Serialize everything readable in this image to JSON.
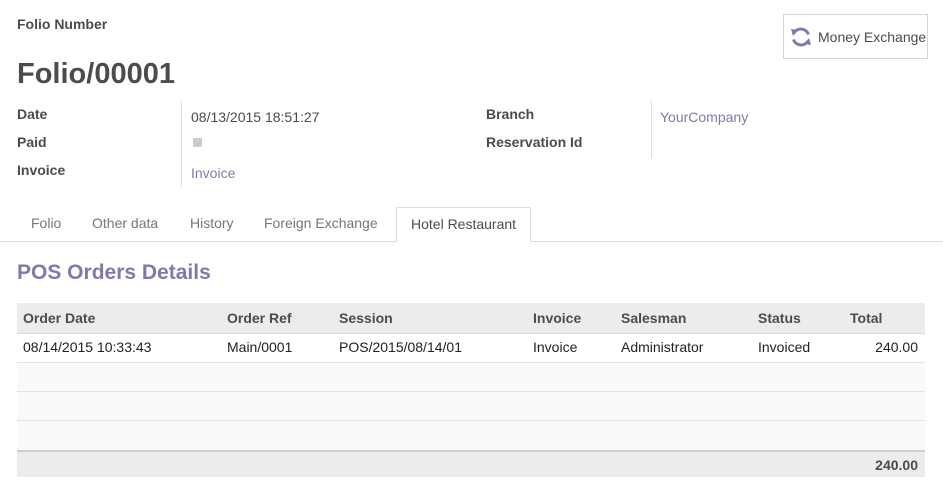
{
  "header": {
    "folio_label": "Folio Number",
    "folio_number": "Folio/00001",
    "money_exchange_label": "Money Exchange"
  },
  "fields": {
    "date_label": "Date",
    "date_value": "08/13/2015 18:51:27",
    "paid_label": "Paid",
    "paid_checked": false,
    "invoice_label": "Invoice",
    "invoice_value": "Invoice",
    "branch_label": "Branch",
    "branch_value": "YourCompany",
    "reservation_label": "Reservation Id",
    "reservation_value": ""
  },
  "tabs": [
    {
      "label": "Folio",
      "active": false
    },
    {
      "label": "Other data",
      "active": false
    },
    {
      "label": "History",
      "active": false
    },
    {
      "label": "Foreign Exchange",
      "active": false
    },
    {
      "label": "Hotel Restaurant",
      "active": true
    }
  ],
  "pos_section": {
    "title": "POS Orders Details",
    "columns": [
      "Order Date",
      "Order Ref",
      "Session",
      "Invoice",
      "Salesman",
      "Status",
      "Total"
    ],
    "rows": [
      {
        "order_date": "08/14/2015 10:33:43",
        "order_ref": "Main/0001",
        "session": "POS/2015/08/14/01",
        "invoice": "Invoice",
        "salesman": "Administrator",
        "status": "Invoiced",
        "total": "240.00"
      }
    ],
    "footer_total": "240.00"
  },
  "colors": {
    "accent": "#7c7bad",
    "text": "#4c4c4c"
  }
}
